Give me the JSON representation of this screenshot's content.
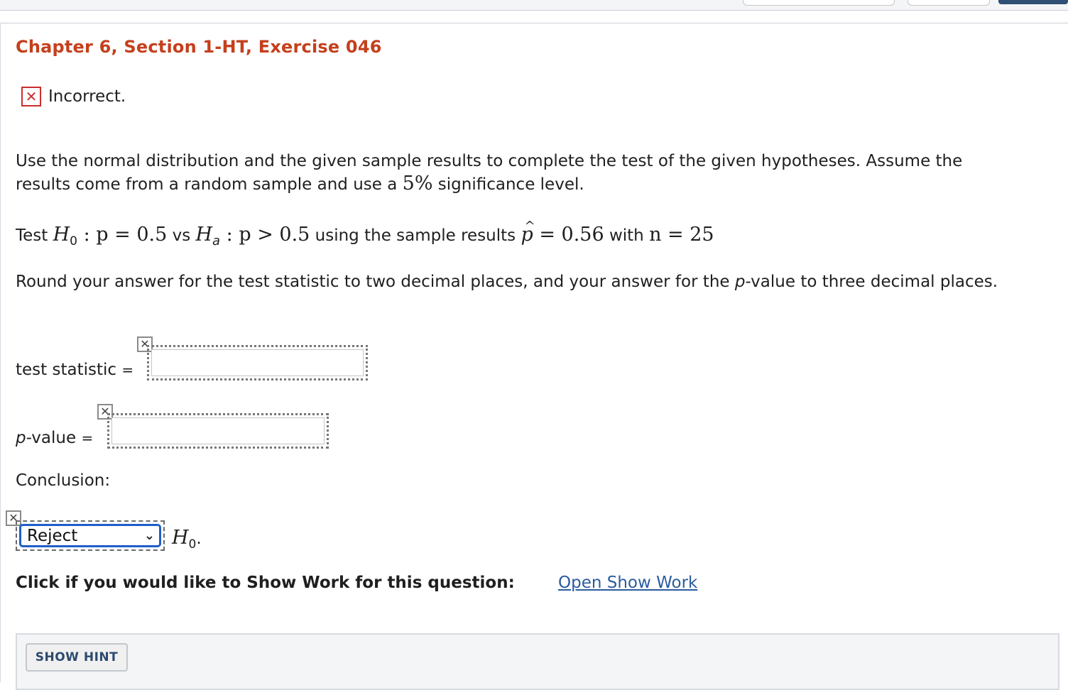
{
  "title": "Chapter 6, Section 1-HT, Exercise 046",
  "status": {
    "icon": "incorrect-x-icon",
    "text": "Incorrect."
  },
  "intro": {
    "line1": "Use the normal distribution and the given sample results to complete the test of the given hypotheses. Assume the",
    "line2_a": "results come from a random sample and use a ",
    "line2_pct": "5%",
    "line2_b": " significance level."
  },
  "test": {
    "test_word": "Test ",
    "h0_symbol": "H",
    "h0_sub": "0",
    "h0_expr": " : p = 0.5",
    "vs": " vs ",
    "ha_symbol": "H",
    "ha_sub": "a",
    "ha_expr": " : p > 0.5",
    "using": " using the sample results ",
    "phat": "p",
    "phat_hat": "^",
    "phat_expr": " = 0.56",
    "with": " with ",
    "n_expr": "n = 25"
  },
  "round_instruction": {
    "a": "Round your answer for the test statistic to two decimal places, and your answer for the ",
    "p": "p",
    "b": "-value to three decimal places."
  },
  "test_statistic": {
    "label": "test statistic",
    "eq": "=",
    "value": ""
  },
  "p_value": {
    "label_p": "p",
    "label_rest": "-value",
    "eq": "=",
    "value": ""
  },
  "conclusion": {
    "label": "Conclusion:",
    "selected": "Reject",
    "h0_symbol": "H",
    "h0_sub": "0",
    "period": "."
  },
  "show_work": {
    "label": "Click if you would like to Show Work for this question:",
    "link": "Open Show Work"
  },
  "hint": {
    "button": "SHOW HINT"
  },
  "colors": {
    "title": "#c4401d",
    "incorrect": "#c9302c",
    "link": "#2a5c9e",
    "select_border": "#1f5fc9"
  }
}
